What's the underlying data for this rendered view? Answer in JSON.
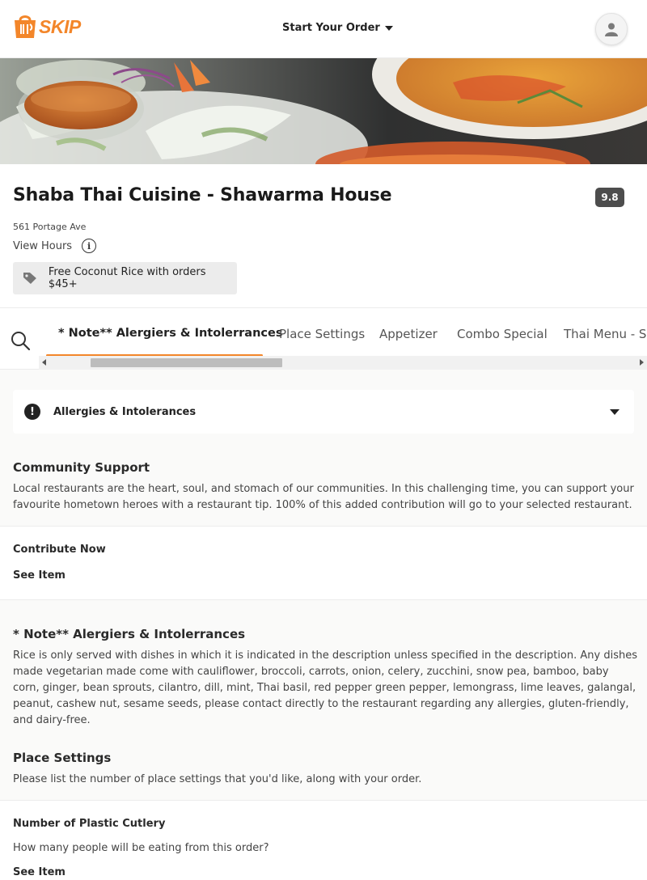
{
  "header": {
    "logo_text": "SKIP",
    "start_order_label": "Start Your Order",
    "colors": {
      "brand": "#f3862a"
    }
  },
  "restaurant": {
    "name": "Shaba Thai Cuisine - Shawarma House",
    "rating": "9.8",
    "address": "561 Portage Ave",
    "view_hours_label": "View Hours",
    "promo": "Free Coconut Rice with orders $45+"
  },
  "tabs": [
    {
      "label": "* Note** Alergiers & Intolerrances",
      "active": true
    },
    {
      "label": "Place Settings",
      "active": false
    },
    {
      "label": "Appetizer",
      "active": false
    },
    {
      "label": "Combo Special",
      "active": false
    },
    {
      "label": "Thai Menu - Soup",
      "active": false
    }
  ],
  "allergies": {
    "label": "Allergies & Intolerances"
  },
  "community": {
    "title": "Community Support",
    "description": "Local restaurants are the heart, soul, and stomach of our communities. In this challenging time, you can support your favourite hometown heroes with a restaurant tip. 100% of this added contribution will go to your selected restaurant.",
    "item_name": "Contribute Now",
    "see_item": "See Item"
  },
  "note_section": {
    "title": "* Note** Alergiers & Intolerrances",
    "description": "Rice is only served with dishes in which it is indicated in the description unless specified in the description. Any dishes made vegetarian made come with cauliflower, broccoli, carrots, onion, celery, zucchini, snow pea, bamboo, baby corn, ginger, bean sprouts, cilantro, dill, mint, Thai basil, red pepper green pepper, lemongrass, lime leaves, galangal, peanut, cashew nut, sesame seeds, please contact directly to the restaurant regarding any allergies, gluten-friendly, and dairy-free."
  },
  "place_settings": {
    "title": "Place Settings",
    "description": "Please list the number of place settings that you'd like, along with your order.",
    "item_name": "Number of Plastic Cutlery",
    "item_desc": "How many people will be eating from this order?",
    "see_item": "See Item"
  }
}
